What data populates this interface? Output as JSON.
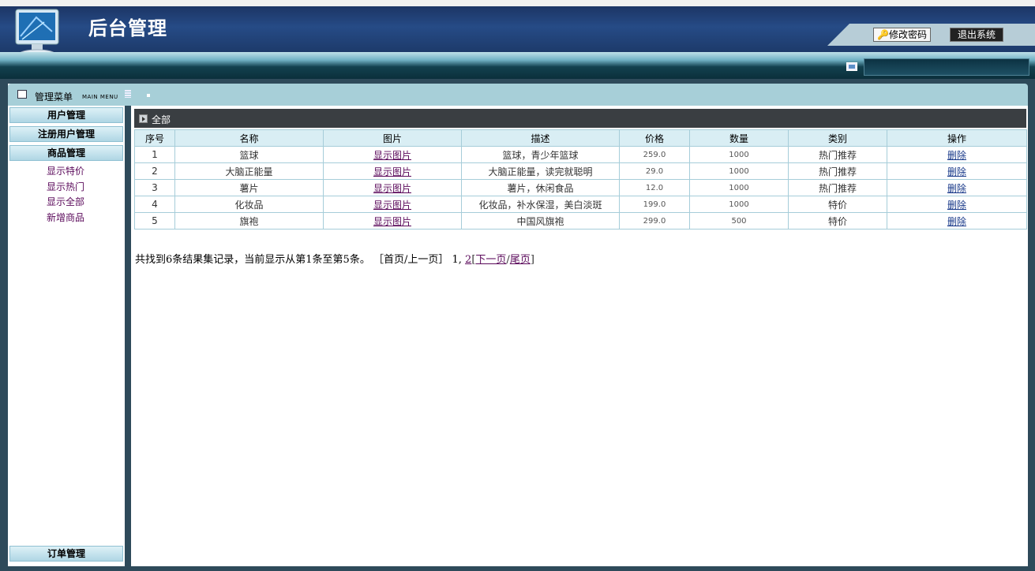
{
  "header": {
    "title": "后台管理",
    "change_password": "修改密码",
    "logout": "退出系统"
  },
  "menu": {
    "title": "管理菜单",
    "subtitle": "MAIN MENU"
  },
  "sidebar": {
    "sections": [
      "用户管理",
      "注册用户管理",
      "商品管理"
    ],
    "items": [
      "显示特价",
      "显示热门",
      "显示全部",
      "新增商品"
    ],
    "bottom": "订单管理"
  },
  "breadcrumb": "全部",
  "table": {
    "headers": [
      "序号",
      "名称",
      "图片",
      "描述",
      "价格",
      "数量",
      "类别",
      "操作"
    ],
    "rows": [
      {
        "id": "1",
        "name": "篮球",
        "image": "显示图片",
        "desc": "篮球，青少年篮球",
        "price": "259.0",
        "qty": "1000",
        "category": "热门推荐",
        "action": "删除"
      },
      {
        "id": "2",
        "name": "大脑正能量",
        "image": "显示图片",
        "desc": "大脑正能量，读完就聪明",
        "price": "29.0",
        "qty": "1000",
        "category": "热门推荐",
        "action": "删除"
      },
      {
        "id": "3",
        "name": "薯片",
        "image": "显示图片",
        "desc": "薯片，休闲食品",
        "price": "12.0",
        "qty": "1000",
        "category": "热门推荐",
        "action": "删除"
      },
      {
        "id": "4",
        "name": "化妆品",
        "image": "显示图片",
        "desc": "化妆品，补水保湿，美白淡斑",
        "price": "199.0",
        "qty": "1000",
        "category": "特价",
        "action": "删除"
      },
      {
        "id": "5",
        "name": "旗袍",
        "image": "显示图片",
        "desc": "中国风旗袍",
        "price": "299.0",
        "qty": "500",
        "category": "特价",
        "action": "删除"
      }
    ]
  },
  "pager": {
    "summary": "共找到6条结果集记录，当前显示从第1条至第5条。",
    "first_prev": "［首页/上一页］",
    "page1": "1,",
    "page2": "2",
    "next": "下一页",
    "last": "尾页"
  },
  "colors": {
    "header": "#1c3565",
    "menu_bar": "#a7cfd8",
    "link": "#5b0a5b"
  }
}
